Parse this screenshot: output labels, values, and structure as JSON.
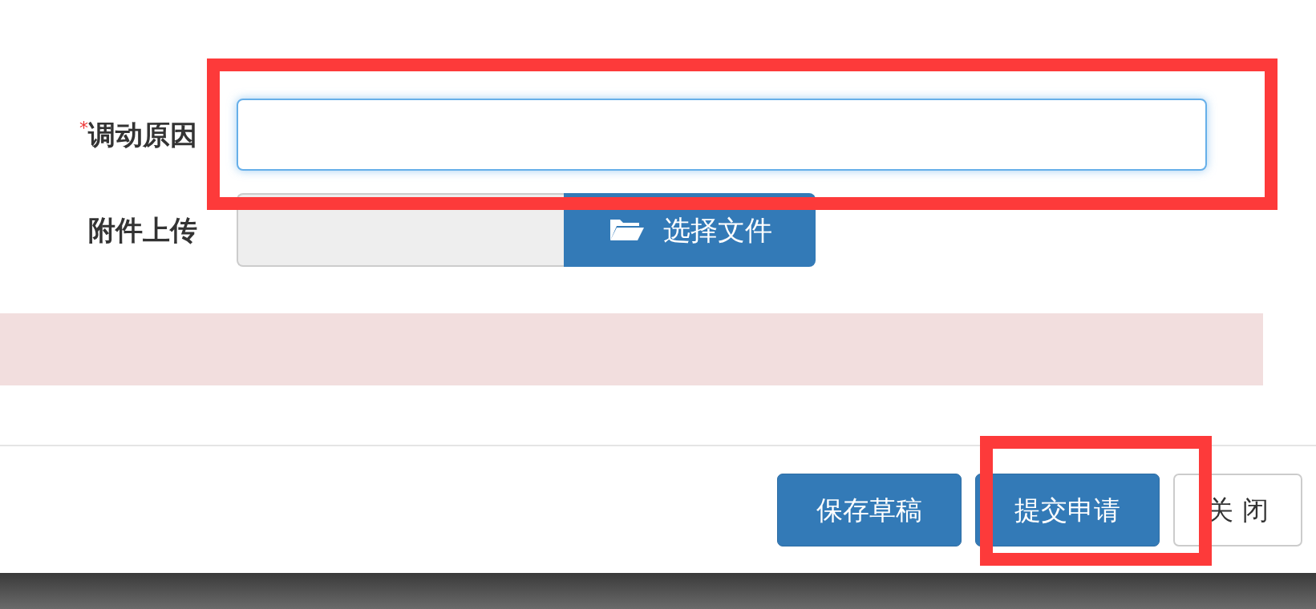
{
  "form": {
    "fields": [
      {
        "kind": "text",
        "mark": "*",
        "label": "调动原因",
        "focused": true
      },
      {
        "kind": "file",
        "label": "附件上传",
        "button": "选择文件",
        "focused": false
      }
    ]
  },
  "alert": {
    "kind": "danger"
  },
  "footer": {
    "buttons": [
      {
        "label": "保存草稿",
        "kind": "primary"
      },
      {
        "label": "提交申请",
        "kind": "primary"
      },
      {
        "label": "关 闭",
        "kind": "default"
      }
    ]
  },
  "annotations": [
    {
      "kind": "highlight"
    },
    {
      "kind": "highlight"
    }
  ]
}
